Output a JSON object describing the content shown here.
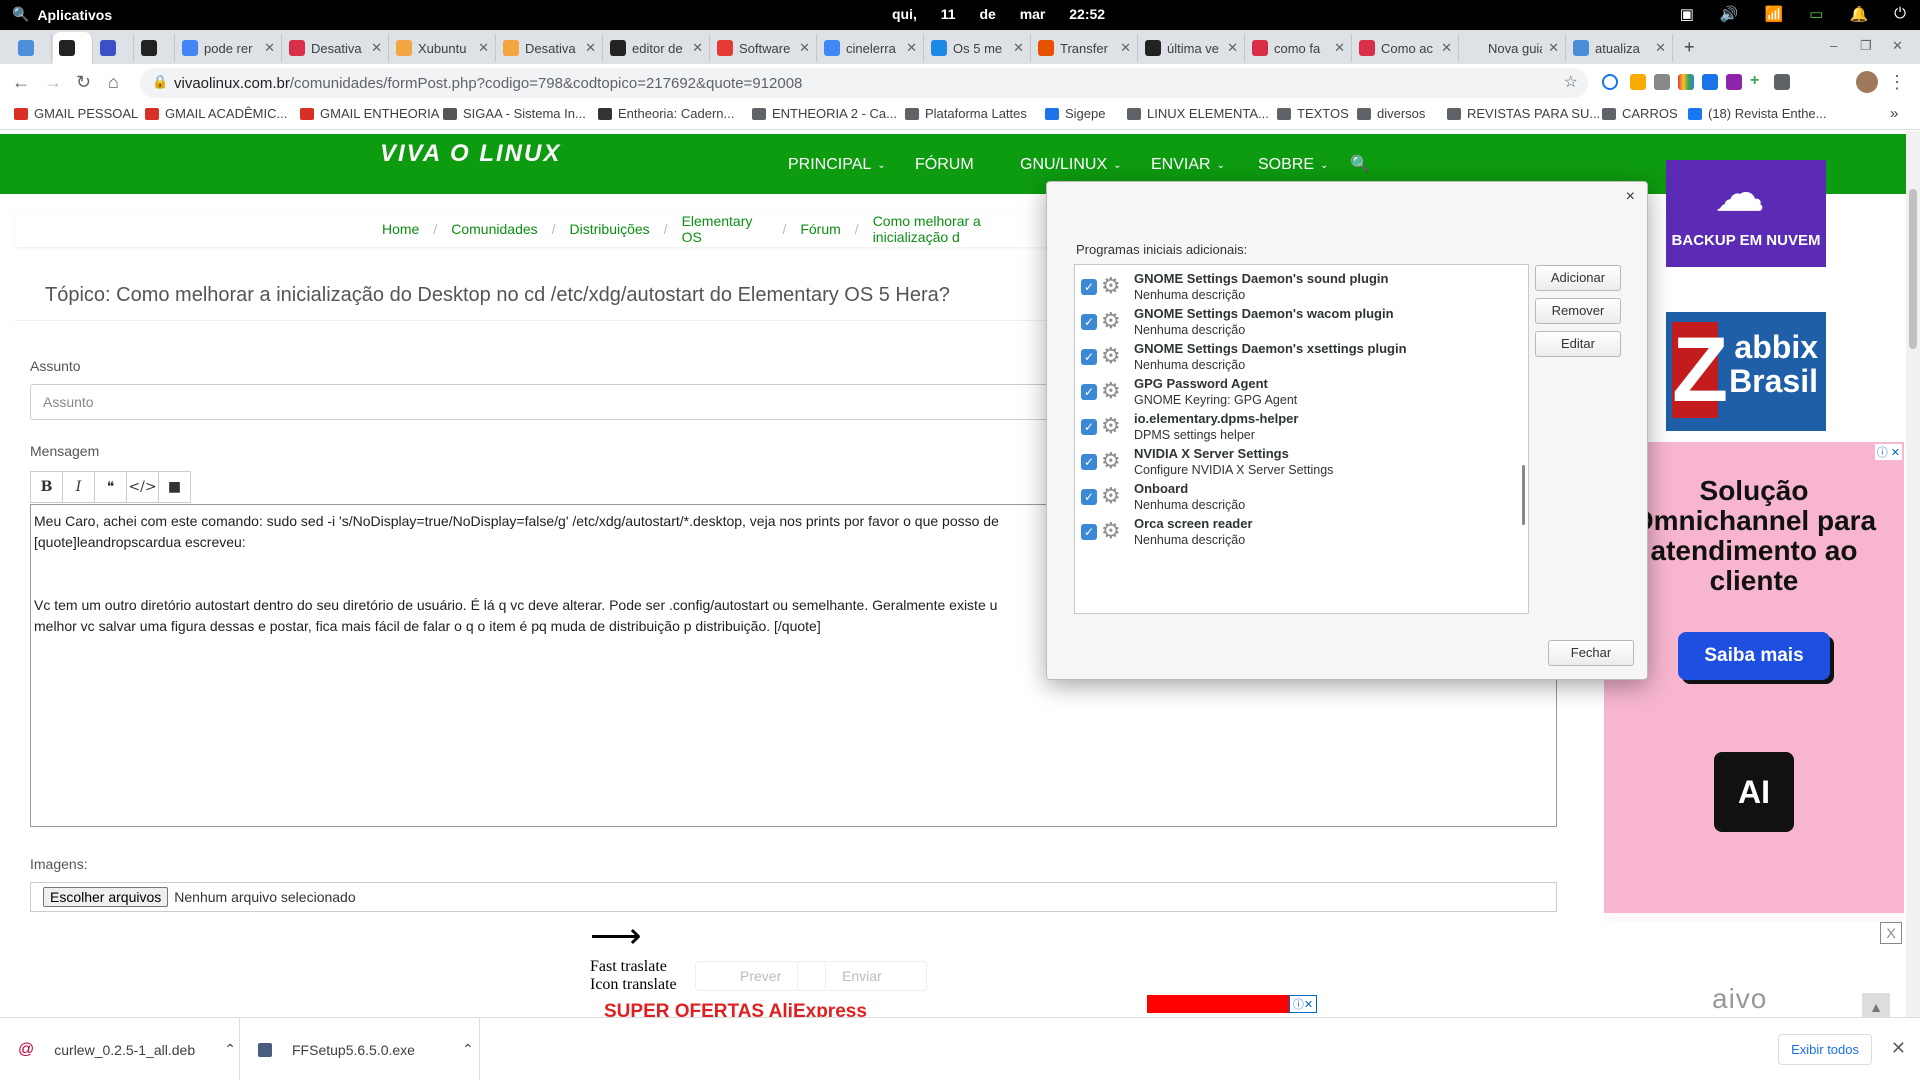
{
  "system": {
    "apps_label": "Aplicativos",
    "date": "qui, 11 de mar",
    "time": "22:52"
  },
  "tabs": [
    {
      "title": "",
      "color": "#4a8fd8",
      "active": false
    },
    {
      "title": "",
      "color": "#222222",
      "active": true
    },
    {
      "title": "",
      "color": "#3b50c4",
      "active": false
    },
    {
      "title": "",
      "color": "#222222",
      "active": false
    },
    {
      "title": "pode rer",
      "color": "#4285f4",
      "active": false
    },
    {
      "title": "Desativa",
      "color": "#d9304a",
      "active": false
    },
    {
      "title": "Xubuntu",
      "color": "#f2a541",
      "active": false
    },
    {
      "title": "Desativa",
      "color": "#f2a541",
      "active": false
    },
    {
      "title": "editor de",
      "color": "#222222",
      "active": false
    },
    {
      "title": "Software",
      "color": "#e53935",
      "active": false
    },
    {
      "title": "cinelerra",
      "color": "#4285f4",
      "active": false
    },
    {
      "title": "Os 5 me",
      "color": "#1e88e5",
      "active": false
    },
    {
      "title": "Transfer",
      "color": "#e65100",
      "active": false
    },
    {
      "title": "última ve",
      "color": "#222222",
      "active": false
    },
    {
      "title": "como fa",
      "color": "#d9304a",
      "active": false
    },
    {
      "title": "Como ac",
      "color": "#d9304a",
      "active": false
    },
    {
      "title": "Nova guia",
      "color": "",
      "active": false
    },
    {
      "title": "atualiza",
      "color": "#4a8fd8",
      "active": false
    }
  ],
  "url": {
    "host": "vivaolinux.com.br",
    "path": "/comunidades/formPost.php?codigo=798&codtopico=217692&quote=912008"
  },
  "bookmarks": [
    {
      "label": "GMAIL PESSOAL",
      "icon": "gmail-icon"
    },
    {
      "label": "GMAIL ACADÊMIC...",
      "icon": "gmail-icon"
    },
    {
      "label": "GMAIL ENTHEORIA",
      "icon": "gmail-icon"
    },
    {
      "label": "SIGAA - Sistema In...",
      "icon": "sigaa-icon"
    },
    {
      "label": "Entheoria: Cadern...",
      "icon": "pkp-icon"
    },
    {
      "label": "ENTHEORIA 2 - Ca...",
      "icon": "globe-icon"
    },
    {
      "label": "Plataforma Lattes",
      "icon": "globe-icon"
    },
    {
      "label": "Sigepe",
      "icon": "sigepe-icon"
    },
    {
      "label": "LINUX ELEMENTA...",
      "icon": "folder-icon"
    },
    {
      "label": "TEXTOS",
      "icon": "folder-icon"
    },
    {
      "label": "diversos",
      "icon": "folder-icon"
    },
    {
      "label": "REVISTAS PARA SU...",
      "icon": "folder-icon"
    },
    {
      "label": "CARROS",
      "icon": "folder-icon"
    },
    {
      "label": "(18) Revista Enthe...",
      "icon": "facebook-icon"
    }
  ],
  "site": {
    "logo": "VIVA O LINUX",
    "menu": [
      {
        "label": "PRINCIPAL",
        "caret": true
      },
      {
        "label": "FÓRUM",
        "caret": false
      },
      {
        "label": "GNU/LINUX",
        "caret": true
      },
      {
        "label": "ENVIAR",
        "caret": true
      },
      {
        "label": "SOBRE",
        "caret": true
      }
    ],
    "breadcrumbs": [
      "Home",
      "Comunidades",
      "Distribuições",
      "Elementary OS",
      "Fórum",
      "Como melhorar a inicialização d"
    ],
    "topic_title": "Tópico: Como melhorar a inicialização do Desktop no cd /etc/xdg/autostart do Elementary OS 5 Hera?",
    "assunto_label": "Assunto",
    "assunto_placeholder": "Assunto",
    "mensagem_label": "Mensagem",
    "toolbar": [
      "B",
      "I",
      "❝",
      "</>",
      "■"
    ],
    "message_lines": [
      "Meu Caro, achei com este comando: sudo sed -i 's/NoDisplay=true/NoDisplay=false/g' /etc/xdg/autostart/*.desktop, veja nos prints por favor o que posso de",
      "[quote]leandropscardua escreveu:",
      "",
      "",
      "Vc tem um outro diretório autostart dentro do seu diretório de usuário. É lá q vc deve alterar. Pode ser .config/autostart ou semelhante. Geralmente existe u",
      "melhor vc salvar uma figura dessas e postar, fica mais fácil de falar o q o item é pq muda de distribuição p distribuição. [/quote]"
    ],
    "imagens_label": "Imagens:",
    "file_button": "Escolher arquivos",
    "file_status": "Nenhum arquivo selecionado",
    "prever": "Prever",
    "enviar": "Enviar"
  },
  "ads": {
    "backup": "BACKUP EM NUVEM",
    "zabbix_line1": "abbix",
    "zabbix_line2": "Brasil",
    "zabbix_z": "Z",
    "omni_title": "Solução Omnichannel para atendimento ao cliente",
    "omni_cta": "Saiba mais",
    "omni_chip": "AI",
    "aivo": "aivo",
    "aliexpress": "SUPER OFERTAS AliExpress"
  },
  "overlay": {
    "fast_translate": "Fast traslate",
    "icon_translate": "Icon translate"
  },
  "dialog": {
    "header": "Programas iniciais adicionais:",
    "items": [
      {
        "name": "GNOME Settings Daemon's sound plugin",
        "desc": "Nenhuma descrição",
        "checked": true
      },
      {
        "name": "GNOME Settings Daemon's wacom plugin",
        "desc": "Nenhuma descrição",
        "checked": true
      },
      {
        "name": "GNOME Settings Daemon's xsettings plugin",
        "desc": "Nenhuma descrição",
        "checked": true
      },
      {
        "name": "GPG Password Agent",
        "desc": "GNOME Keyring: GPG Agent",
        "checked": true
      },
      {
        "name": "io.elementary.dpms-helper",
        "desc": "DPMS settings helper",
        "checked": true
      },
      {
        "name": "NVIDIA X Server Settings",
        "desc": "Configure NVIDIA X Server Settings",
        "checked": true
      },
      {
        "name": "Onboard",
        "desc": "Nenhuma descrição",
        "checked": true
      },
      {
        "name": "Orca screen reader",
        "desc": "Nenhuma descrição",
        "checked": true
      }
    ],
    "add": "Adicionar",
    "remove": "Remover",
    "edit": "Editar",
    "close": "Fechar"
  },
  "downloads": [
    {
      "name": "curlew_0.2.5-1_all.deb",
      "icon": "debian-icon"
    },
    {
      "name": "FFSetup5.6.5.0.exe",
      "icon": "exe-icon"
    }
  ],
  "downloads_show_all": "Exibir todos"
}
